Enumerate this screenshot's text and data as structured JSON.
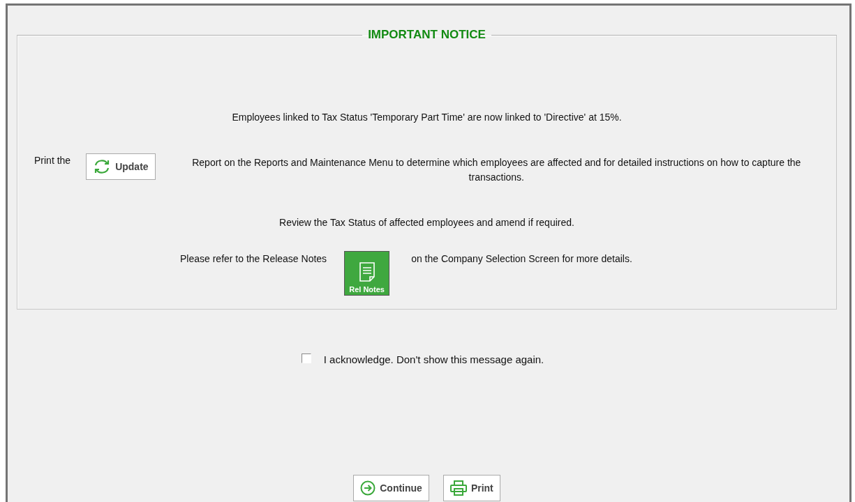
{
  "notice": {
    "title": "IMPORTANT NOTICE",
    "line_1": "Employees linked to Tax Status 'Temporary Part Time' are now linked to 'Directive' at 15%.",
    "print_prefix": "Print the",
    "update_button": "Update",
    "print_text": "Report on the Reports and Maintenance Menu to determine which employees are affected and for detailed instructions on how to capture the transactions.",
    "line_3": "Review the Tax Status of affected employees and amend if required.",
    "refer_prefix": "Please refer to the Release Notes",
    "rel_notes_button": "Rel Notes",
    "refer_suffix": "on the Company Selection Screen for more details."
  },
  "acknowledge": {
    "label": "I acknowledge. Don't show this message again.",
    "checked": false
  },
  "buttons": [
    {
      "kind": "continue",
      "label": "Continue"
    },
    {
      "kind": "print",
      "label": "Print"
    }
  ]
}
